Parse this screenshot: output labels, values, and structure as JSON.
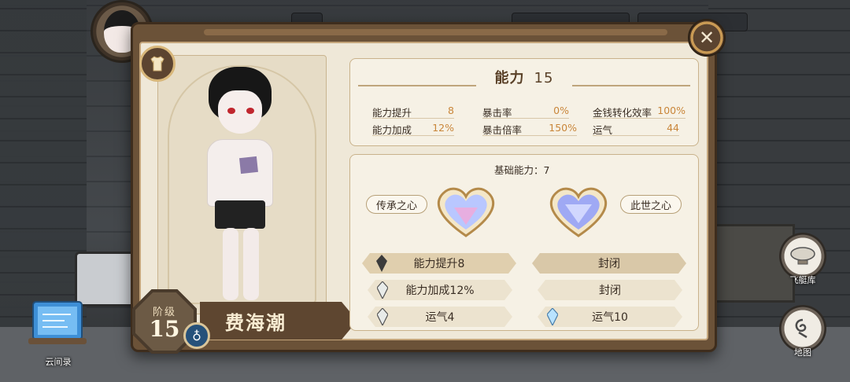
{
  "title": {
    "label": "能力",
    "value": "15"
  },
  "character": {
    "name": "费海潮",
    "level_label": "阶级",
    "level": "15"
  },
  "stats": [
    {
      "key": "能力提升",
      "value": "8"
    },
    {
      "key": "能力加成",
      "value": "12%"
    },
    {
      "key": "暴击率",
      "value": "0%"
    },
    {
      "key": "暴击倍率",
      "value": "150%"
    },
    {
      "key": "金钱转化效率",
      "value": "100%"
    },
    {
      "key": "运气",
      "value": "44"
    }
  ],
  "base_ability": "基础能力：7",
  "hearts": {
    "left": "传承之心",
    "right": "此世之心"
  },
  "left_slots": [
    "能力提升8",
    "能力加成12%",
    "运气4"
  ],
  "right_slots": [
    "封闭",
    "封闭",
    "运气10"
  ],
  "side_nav": {
    "airship": "飞艇库",
    "map": "地图",
    "cloud": "云间录"
  },
  "colors": {
    "accent_value": "#c9863a",
    "panel_frame": "#6b5238",
    "panel_bg": "#efe8d8"
  },
  "icons": {
    "close": "close-icon",
    "shirt": "shirt-icon",
    "ring": "ring-icon",
    "airship": "airship-icon",
    "map": "map-icon",
    "cloud_book": "book-icon"
  }
}
